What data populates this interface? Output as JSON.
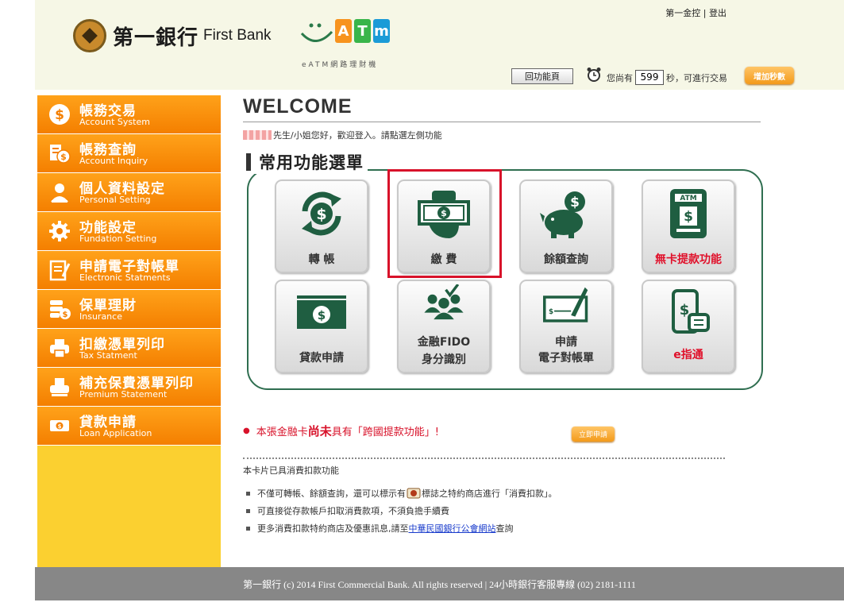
{
  "top_links": {
    "group": "第一金控",
    "separator": "|",
    "logout": "登出"
  },
  "logo": {
    "name_zh": "第一銀行",
    "name_en": "First Bank"
  },
  "eatm": {
    "tiles": [
      "A",
      "T",
      "m"
    ],
    "tile_colors": [
      "#f7931e",
      "#39b54a",
      "#1b9bd7"
    ],
    "subtitle": "eATM網路理財機"
  },
  "toolbar": {
    "back_label": "回功能頁",
    "timer_prefix": "您尚有",
    "timer_value": "599",
    "timer_suffix": "秒，可進行交易",
    "add_time_label": "增加秒數"
  },
  "sidebar": {
    "items": [
      {
        "zh": "帳務交易",
        "en": "Account System",
        "icon": "dollar-icon"
      },
      {
        "zh": "帳務查詢",
        "en": "Account Inquiry",
        "icon": "ledger-icon"
      },
      {
        "zh": "個人資料設定",
        "en": "Personal Setting",
        "icon": "user-icon"
      },
      {
        "zh": "功能設定",
        "en": "Fundation Setting",
        "icon": "gear-icon"
      },
      {
        "zh": "申請電子對帳單",
        "en": "Electronic Statments",
        "icon": "statement-icon"
      },
      {
        "zh": "保單理財",
        "en": "Insurance",
        "icon": "insurance-icon"
      },
      {
        "zh": "扣繳憑單列印",
        "en": "Tax Statment",
        "icon": "printer-icon"
      },
      {
        "zh": "補充保費憑單列印",
        "en": "Premium Statement",
        "icon": "printer-icon"
      },
      {
        "zh": "貸款申請",
        "en": "Loan Application",
        "icon": "cash-icon"
      }
    ]
  },
  "main": {
    "welcome": "WELCOME",
    "greeting": "先生/小姐您好，歡迎登入。請點選左側功能",
    "menu_title": "常用功能選單",
    "tiles": [
      {
        "label": "轉 帳",
        "label2": "",
        "icon": "transfer-icon"
      },
      {
        "label": "繳 費",
        "label2": "",
        "icon": "payment-icon"
      },
      {
        "label": "餘額查詢",
        "label2": "",
        "icon": "piggy-bank-icon"
      },
      {
        "label": "無卡提款功能",
        "label2": "",
        "icon": "atm-icon"
      },
      {
        "label": "貸款申請",
        "label2": "",
        "icon": "banknote-icon"
      },
      {
        "label": "金融FIDO",
        "label2": "身分識別",
        "icon": "fido-icon"
      },
      {
        "label": "申請",
        "label2": "電子對帳單",
        "icon": "cheque-icon"
      },
      {
        "label": "e指通",
        "label2": "",
        "icon": "mobile-pay-icon"
      }
    ]
  },
  "notice": {
    "pre": "本張金融卡",
    "em": "尚未",
    "post": "具有「跨國提款功能」!",
    "apply_label": "立即申請"
  },
  "card_info": {
    "heading": "本卡片已具消費扣款功能",
    "line1_pre": "不僅可轉帳、餘額查詢，還可以標示有",
    "line1_post": "標誌之特約商店進行「消費扣款」。",
    "line2": "可直接從存款帳戶扣取消費款項，不須負擔手續費",
    "line3_pre": "更多消費扣款特約商店及優惠訊息,請至",
    "line3_link": "中華民國銀行公會網站",
    "line3_post": "查詢"
  },
  "footer": "第一銀行 (c) 2014 First Commercial Bank. All rights reserved | 24小時銀行客服專線 (02) 2181-1111",
  "colors": {
    "brand_green": "#2f6e50",
    "sidebar_orange": "#f47f00",
    "sidebar_yellow": "#fbd030",
    "highlight_red": "#d8122a"
  }
}
